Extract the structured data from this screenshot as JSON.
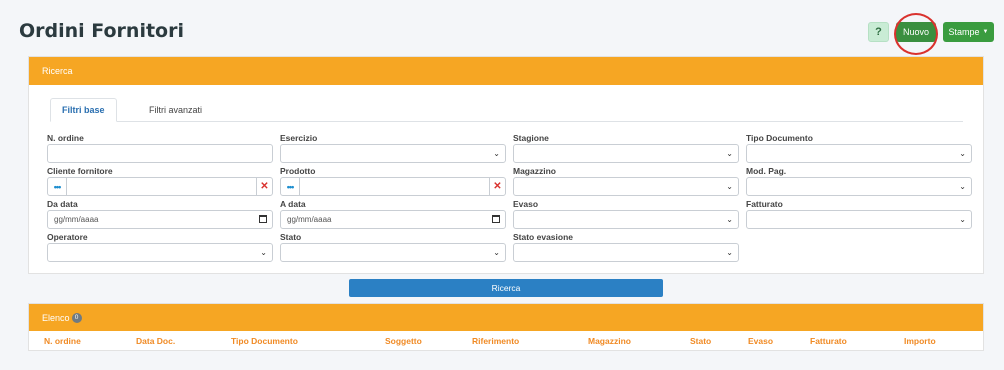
{
  "page": {
    "title": "Ordini Fornitori"
  },
  "toolbar": {
    "help_label": "?",
    "nuovo_label": "Nuovo",
    "stampe_label": "Stampe"
  },
  "search_card": {
    "header": "Ricerca",
    "tabs": [
      "Filtri base",
      "Filtri avanzati"
    ],
    "fields": {
      "n_ordine": "N. ordine",
      "esercizio": "Esercizio",
      "stagione": "Stagione",
      "tipo_documento": "Tipo Documento",
      "cliente_fornitore": "Cliente fornitore",
      "prodotto": "Prodotto",
      "magazzino": "Magazzino",
      "mod_pag": "Mod. Pag.",
      "da_data": "Da data",
      "a_data": "A data",
      "evaso": "Evaso",
      "fatturato": "Fatturato",
      "operatore": "Operatore",
      "stato": "Stato",
      "stato_evasione": "Stato evasione"
    },
    "date_placeholder": "gg/mm/aaaa",
    "lookup_prefix": "•••",
    "lookup_clear": "✕",
    "search_button": "Ricerca"
  },
  "list_card": {
    "header": "Elenco",
    "count": "0",
    "columns": [
      "N. ordine",
      "Data Doc.",
      "Tipo Documento",
      "Soggetto",
      "Riferimento",
      "Magazzino",
      "Stato",
      "Evaso",
      "Fatturato",
      "Importo"
    ]
  },
  "icons": {
    "select_caret": "chevron-down-icon",
    "calendar": "calendar-icon"
  },
  "colors": {
    "header_orange": "#f6a623",
    "primary_blue": "#2b80c4",
    "green": "#3a8f3f",
    "column_orange": "#f08a24",
    "annotation_red": "#d9322e"
  }
}
